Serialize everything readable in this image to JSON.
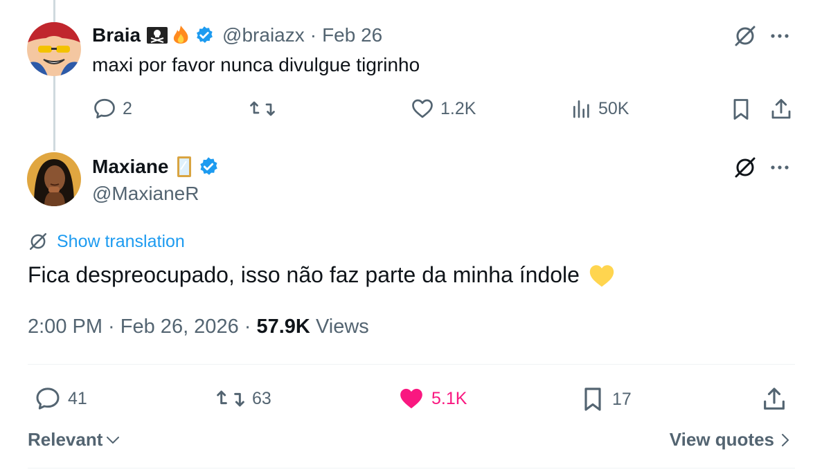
{
  "reply_to": {
    "name": "Braia",
    "handle": "@braiazx",
    "date": "Feb 26",
    "text": "maxi por favor nunca divulgue tigrinho",
    "stats": {
      "replies": "2",
      "retweets": "",
      "likes": "1.2K",
      "views": "50K"
    },
    "avatar": "pirate-character-avatar",
    "emoji": [
      "skull-crossbones-flag-emoji",
      "fire-emoji"
    ]
  },
  "tweet": {
    "name": "Maxiane",
    "handle": "@MaxianeR",
    "emoji": "mirror-emoji",
    "avatar": "woman-portrait-avatar",
    "translation_label": "Show translation",
    "text": "Fica despreocupado, isso não faz parte da minha índole",
    "text_emoji": "yellow-heart-emoji",
    "time": "2:00 PM",
    "date": "Feb 26, 2026",
    "views_count": "57.9K",
    "views_label": "Views",
    "stats": {
      "replies": "41",
      "retweets": "63",
      "likes": "5.1K",
      "bookmarks": "17"
    }
  },
  "footer": {
    "sort_label": "Relevant",
    "quotes_label": "View quotes"
  },
  "colors": {
    "text": "#0f1419",
    "muted": "#536471",
    "link": "#1d9bf0",
    "like_active": "#f91880",
    "verified": "#1d9bf0",
    "yellow_heart": "#ffd54f"
  }
}
